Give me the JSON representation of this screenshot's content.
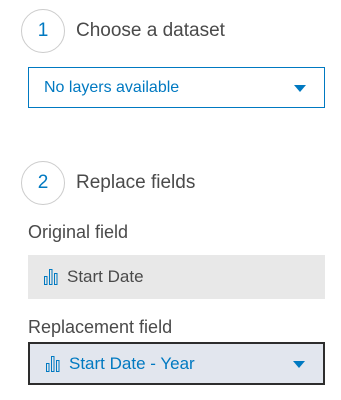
{
  "steps": [
    {
      "number": "1",
      "label": "Choose a dataset"
    },
    {
      "number": "2",
      "label": "Replace fields"
    }
  ],
  "dataset_select": {
    "value": "No layers available"
  },
  "original_field": {
    "label": "Original field",
    "value": "Start Date",
    "icon": "bar-chart-field-icon"
  },
  "replacement_field": {
    "label": "Replacement field",
    "value": "Start Date - Year",
    "icon": "bar-chart-field-icon"
  },
  "colors": {
    "accent": "#0079c1",
    "text": "#4a4a4a",
    "disabled_bg": "#e8e8e8",
    "focus_border": "#2d2d2d"
  }
}
